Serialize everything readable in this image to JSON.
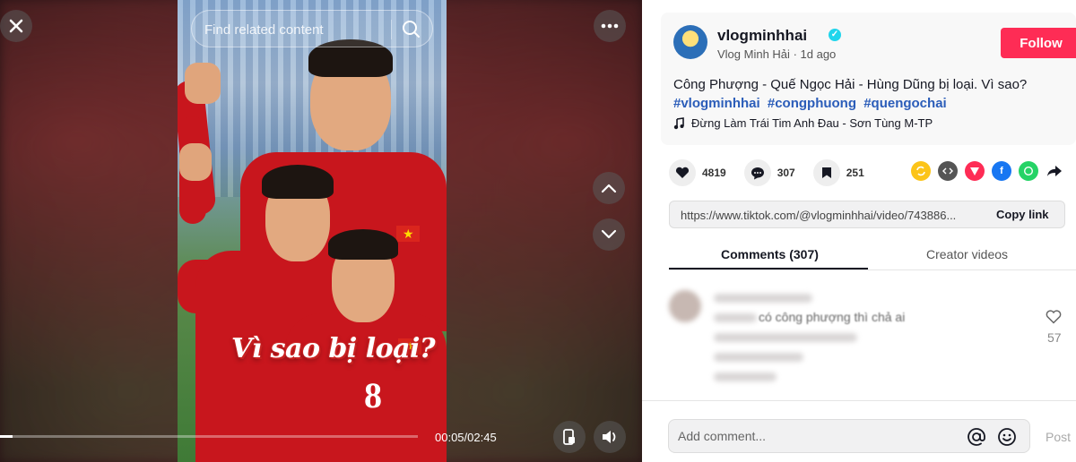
{
  "video": {
    "search": {
      "placeholder": "Find related content"
    },
    "overlay_caption": "Vì sao bị loại?",
    "jersey_number": "8",
    "time": "00:05/02:45",
    "progress": 0.03
  },
  "post": {
    "username": "vlogminhhai",
    "display_name": "Vlog Minh Hải",
    "posted": "1d ago",
    "follow_label": "Follow",
    "description": "Công Phượng - Quế Ngọc Hải - Hùng Dũng bị loại. Vì sao?",
    "hashtags": [
      "#vlogminhhai",
      "#congphuong",
      "#quengochai"
    ],
    "music": "Đừng Làm Trái Tim Anh Đau - Sơn Tùng M-TP"
  },
  "stats": {
    "likes": "4819",
    "comments": "307",
    "saves": "251"
  },
  "share": {
    "link": "https://www.tiktok.com/@vlogminhhai/video/743886...",
    "copy_label": "Copy link",
    "icons": [
      {
        "name": "repost-icon",
        "color": "#fcc419"
      },
      {
        "name": "embed-icon",
        "color": "#555555"
      },
      {
        "name": "send-icon",
        "color": "#fe2c55"
      },
      {
        "name": "facebook-icon",
        "color": "#1877f2"
      },
      {
        "name": "whatsapp-icon",
        "color": "#25d366"
      }
    ]
  },
  "tabs": {
    "comments": "Comments (307)",
    "creator_videos": "Creator videos"
  },
  "comment": {
    "text": "có công phượng thì chả ai",
    "likes": "57"
  },
  "comment_bar": {
    "placeholder": "Add comment...",
    "post_label": "Post"
  }
}
